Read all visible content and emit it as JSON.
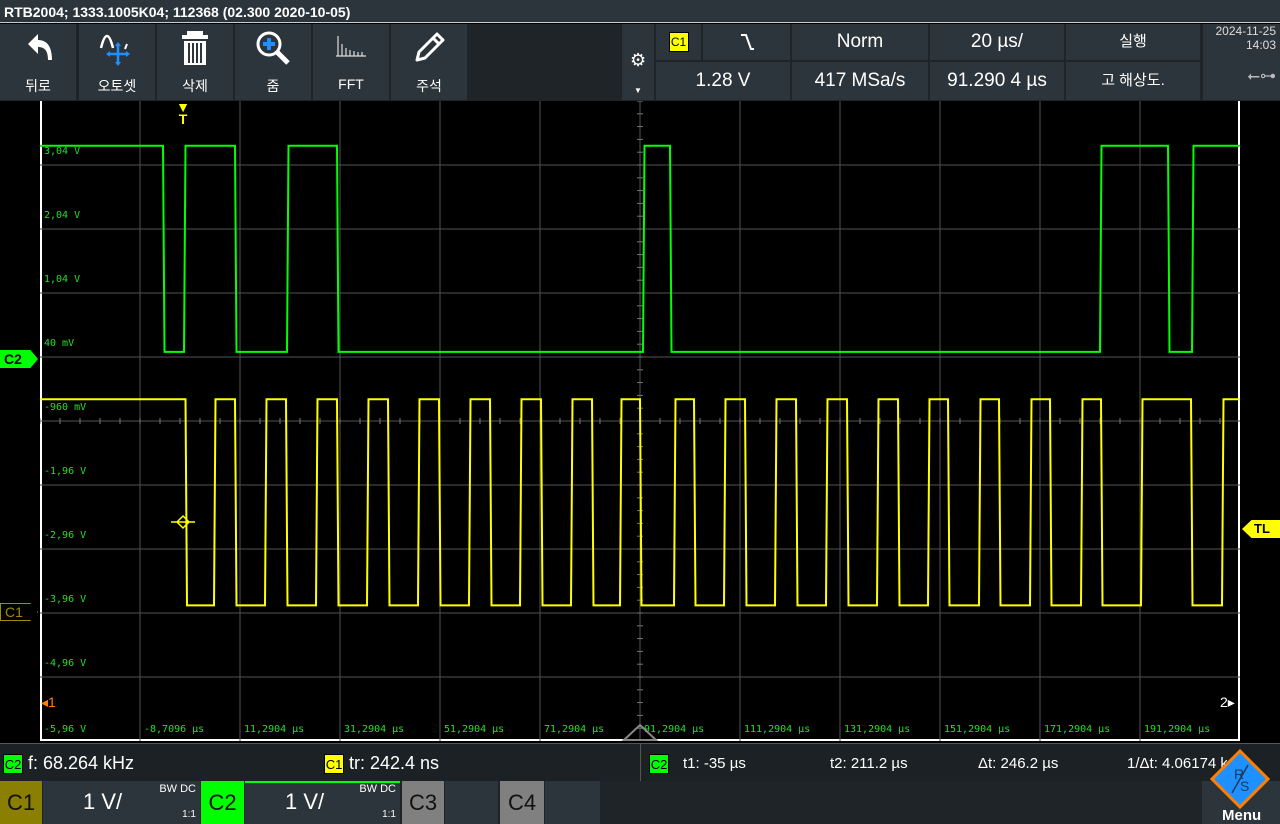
{
  "title_bar": {
    "text": "RTB2004; 1333.1005K04; 112368 (02.300 2020-10-05)"
  },
  "toolbar": {
    "buttons": [
      {
        "label": "뒤로",
        "icon": "undo-arrow-icon"
      },
      {
        "label": "오토셋",
        "icon": "autoset-icon"
      },
      {
        "label": "삭제",
        "icon": "trash-icon"
      },
      {
        "label": "줌",
        "icon": "zoom-in-icon"
      },
      {
        "label": "FFT",
        "icon": "fft-icon"
      },
      {
        "label": "주석",
        "icon": "pencil-icon"
      }
    ]
  },
  "status": {
    "trigger_source": "C1",
    "trigger_slope": "falling-edge-icon",
    "trigger_mode": "Norm",
    "timebase": "20 µs/",
    "run_state": "실행",
    "trigger_level": "1.28 V",
    "sample_rate": "417 MSa/s",
    "horizontal_position": "91.290 4 µs",
    "acquisition_mode": "고 해상도.",
    "date": "2024-11-25",
    "time": "14:03"
  },
  "markers": {
    "trigger": "T",
    "trigger_level": "TL",
    "ch2": "C2",
    "ch1": "C1",
    "ref_left": "1",
    "ref_right": "2"
  },
  "colors": {
    "ch1": "#ffff00",
    "ch2": "#00ff00",
    "grid": "#555555",
    "panel": "#2c353b",
    "accent_orange": "#ff8000",
    "accent_blue": "#1e90ff"
  },
  "chart_data": {
    "type": "line",
    "x_unit": "µs",
    "xlim": [
      -28.7096,
      211.2904
    ],
    "y_tick_labels": [
      "3,04 V",
      "2,04 V",
      "1,04 V",
      "40 mV",
      "-960 mV",
      "-1,96 V",
      "-2,96 V",
      "-3,96 V",
      "-4,96 V",
      "-5,96 V"
    ],
    "x_tick_labels": [
      "-8,7096 µs",
      "11,2904 µs",
      "31,2904 µs",
      "51,2904 µs",
      "71,2904 µs",
      "91,2904 µs",
      "111,2904 µs",
      "131,2904 µs",
      "151,2904 µs",
      "171,2904 µs",
      "191,2904 µs"
    ],
    "ylim": [
      -6.0,
      4.0
    ],
    "grid": true,
    "series": [
      {
        "channel": "C2",
        "color": "#00ff00",
        "high_v": 3.34,
        "low_v": 0.12,
        "start": "high",
        "edges_us": [
          -4.1,
          0.1,
          10.3,
          20.7,
          30.7,
          91.9,
          97.3,
          183.3,
          196.9,
          201.7
        ]
      },
      {
        "channel": "C1",
        "color": "#ffff00",
        "high_v": -0.62,
        "low_v": -3.84,
        "start": "high",
        "edges_us": [
          0.4,
          6.1,
          10.3,
          16.3,
          20.5,
          26.5,
          30.7,
          36.7,
          40.9,
          46.9,
          51.1,
          57.1,
          61.3,
          67.3,
          71.5,
          77.5,
          81.7,
          87.3,
          91.3,
          98.1,
          102.1,
          108.1,
          112.3,
          118.3,
          122.5,
          128.5,
          132.7,
          138.7,
          142.9,
          148.9,
          152.9,
          159.1,
          163.1,
          169.3,
          173.3,
          179.5,
          183.5,
          191.5,
          201.5,
          207.7
        ]
      }
    ]
  },
  "measurements": {
    "m1_source": "C2",
    "m1": "f: 68.264 kHz",
    "m2_source": "C1",
    "m2": "tr: 242.4 ns",
    "cursor_source": "C2",
    "t1": "t1: -35 µs",
    "t2": "t2: 211.2 µs",
    "dt": "Δt: 246.2 µs",
    "inv_dt": "1/Δt: 4.06174 k"
  },
  "channels": [
    {
      "name": "C1",
      "scale": "1 V/",
      "bw": "BW DC",
      "probe": "1:1",
      "color": "#8a7f00"
    },
    {
      "name": "C2",
      "scale": "1 V/",
      "bw": "BW DC",
      "probe": "1:1",
      "color": "#00ff00"
    },
    {
      "name": "C3",
      "color": "#808080"
    },
    {
      "name": "C4",
      "color": "#808080"
    }
  ],
  "menu": {
    "label": "Menu",
    "logo": "R&S"
  }
}
